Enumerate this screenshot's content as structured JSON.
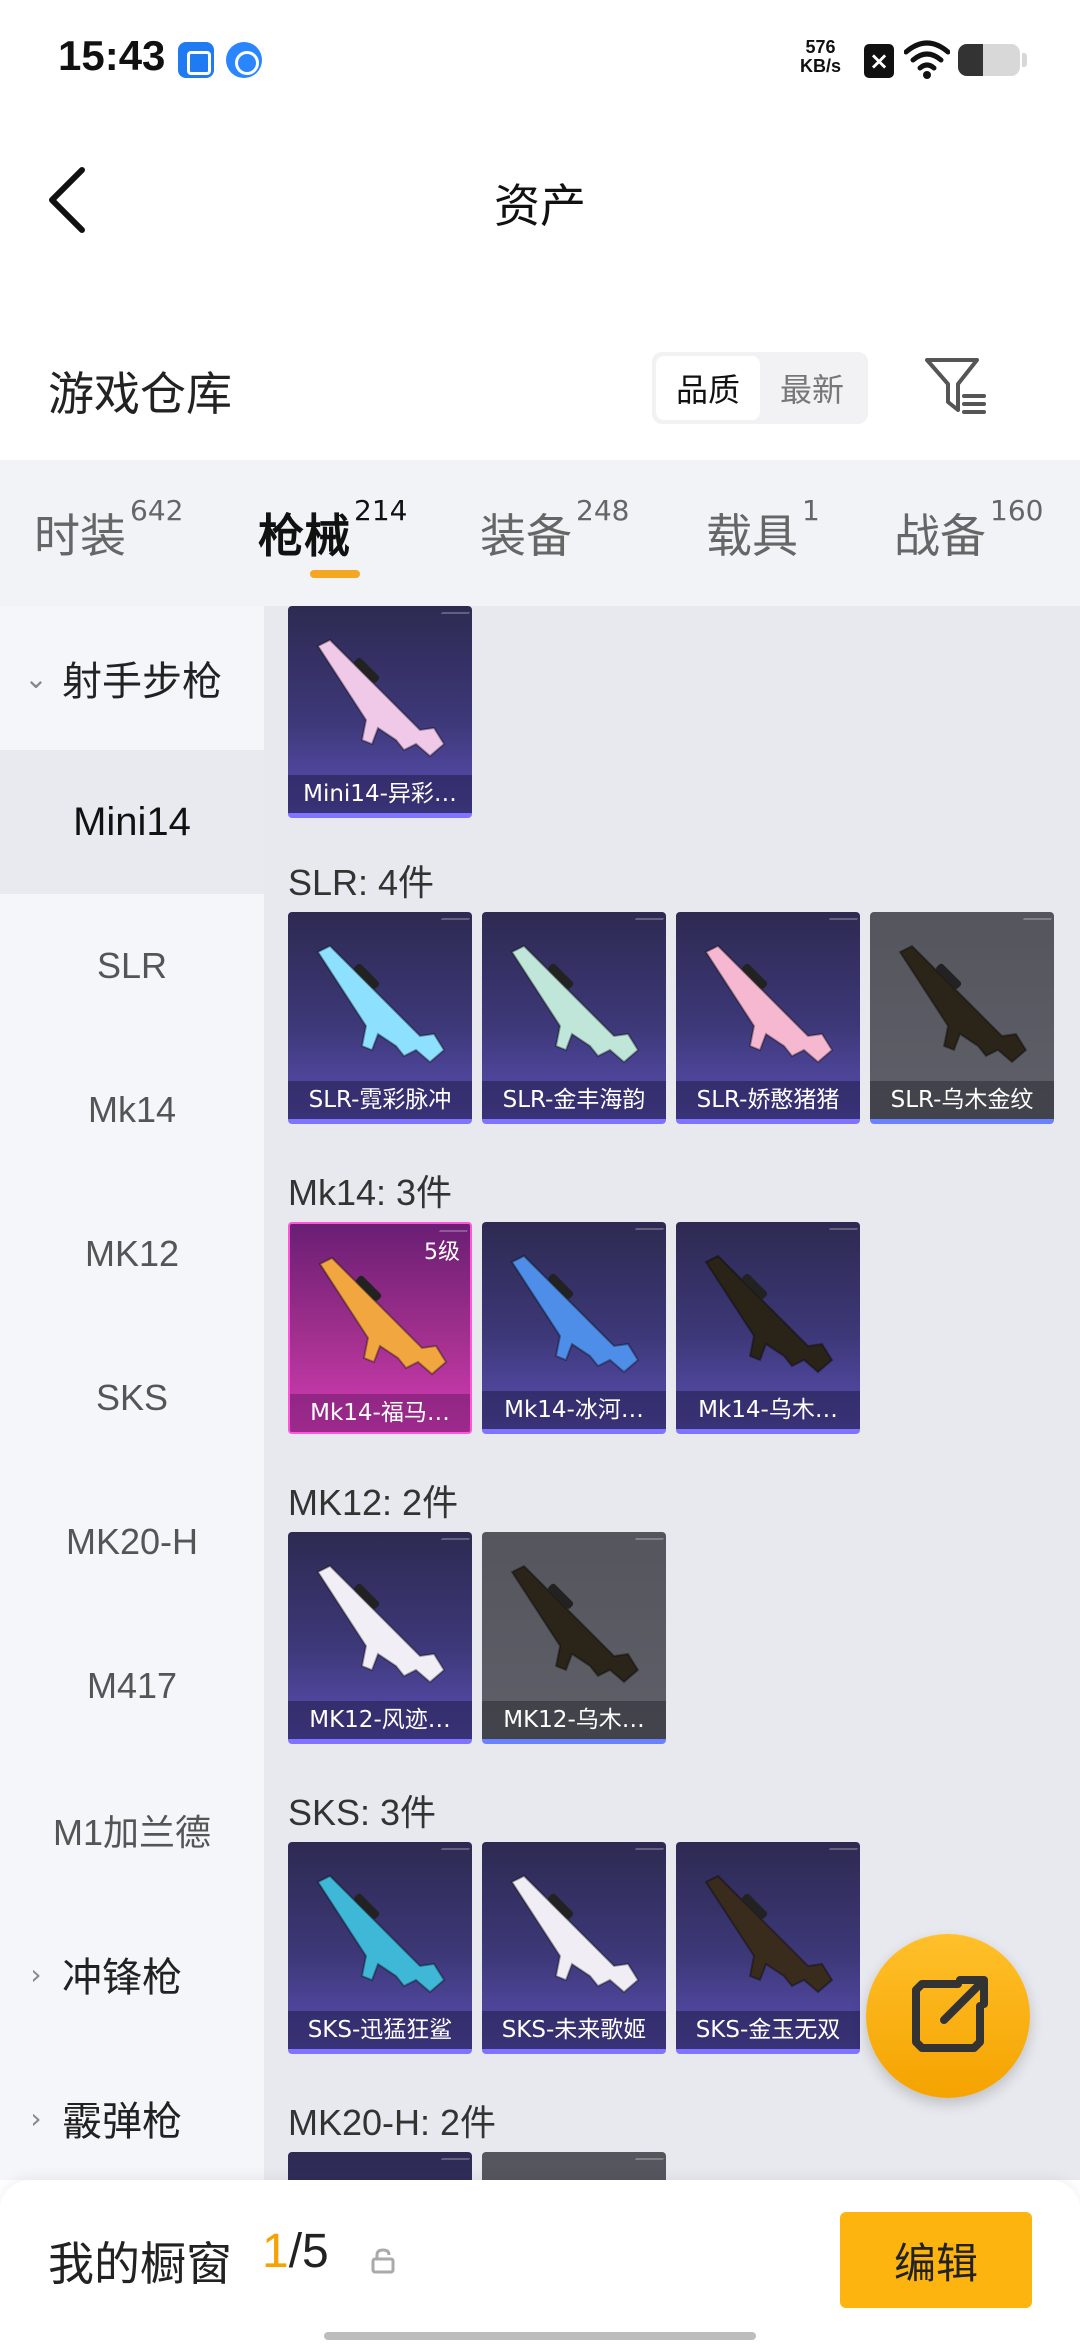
{
  "status_bar": {
    "time": "15:43",
    "speed_value": "576",
    "speed_unit": "KB/s"
  },
  "header": {
    "title": "资产"
  },
  "warehouse": {
    "title": "游戏仓库",
    "sort_options": [
      {
        "label": "品质",
        "active": true
      },
      {
        "label": "最新",
        "active": false
      }
    ]
  },
  "tabs": [
    {
      "label": "时装",
      "count": "642"
    },
    {
      "label": "枪械",
      "count": "214",
      "active": true
    },
    {
      "label": "装备",
      "count": "248"
    },
    {
      "label": "载具",
      "count": "1"
    },
    {
      "label": "战备",
      "count": "160"
    }
  ],
  "sidebar": {
    "categories": [
      {
        "label": "射手步枪",
        "expanded": true
      },
      {
        "label": "冲锋枪",
        "expanded": false
      },
      {
        "label": "霰弹枪",
        "expanded": false
      }
    ],
    "items": [
      {
        "label": "Mini14",
        "active": true
      },
      {
        "label": "SLR"
      },
      {
        "label": "Mk14"
      },
      {
        "label": "MK12"
      },
      {
        "label": "SKS"
      },
      {
        "label": "MK20-H"
      },
      {
        "label": "M417"
      },
      {
        "label": "M1加兰德"
      }
    ]
  },
  "groups": [
    {
      "label": "",
      "items": [
        {
          "name": "Mini14-异彩…",
          "style": "purple",
          "gun_color": "#f0c8e8"
        }
      ]
    },
    {
      "label": "SLR: 4件",
      "items": [
        {
          "name": "SLR-霓彩脉冲",
          "style": "purple",
          "gun_color": "#8ee0ff"
        },
        {
          "name": "SLR-金丰海韵",
          "style": "purple",
          "gun_color": "#bfe6d8"
        },
        {
          "name": "SLR-娇憨猪猪",
          "style": "purple",
          "gun_color": "#f6b8d0"
        },
        {
          "name": "SLR-乌木金纹",
          "style": "gray",
          "gun_color": "#2b2418"
        }
      ]
    },
    {
      "label": "Mk14: 3件",
      "items": [
        {
          "name": "Mk14-福马…",
          "style": "pink",
          "gun_color": "#f2a640",
          "level": "5级"
        },
        {
          "name": "Mk14-冰河…",
          "style": "purple",
          "gun_color": "#4f8ee8"
        },
        {
          "name": "Mk14-乌木…",
          "style": "purple",
          "gun_color": "#2a2418"
        }
      ]
    },
    {
      "label": "MK12: 2件",
      "items": [
        {
          "name": "MK12-风迹…",
          "style": "purple",
          "gun_color": "#f2eef6"
        },
        {
          "name": "MK12-乌木…",
          "style": "gray",
          "gun_color": "#2b2418"
        }
      ]
    },
    {
      "label": "SKS: 3件",
      "items": [
        {
          "name": "SKS-迅猛狂鲨",
          "style": "purple",
          "gun_color": "#3fb8d8"
        },
        {
          "name": "SKS-未来歌姬",
          "style": "purple",
          "gun_color": "#f0eef4"
        },
        {
          "name": "SKS-金玉无双",
          "style": "purple",
          "gun_color": "#3a2c1c"
        }
      ]
    },
    {
      "label": "MK20-H: 2件",
      "items": [
        {
          "name": "",
          "style": "purple",
          "gun_color": "#cccccc"
        },
        {
          "name": "",
          "style": "gray",
          "gun_color": "#333333"
        }
      ]
    }
  ],
  "bottom": {
    "title": "我的橱窗",
    "count_current": "1",
    "count_total": "/5",
    "edit_label": "编辑"
  },
  "colors": {
    "accent": "#f5a623",
    "button": "#fdb40f",
    "card_purple": "#3d3878",
    "card_gray": "#5f5f69",
    "card_pink": "#a2308e"
  }
}
